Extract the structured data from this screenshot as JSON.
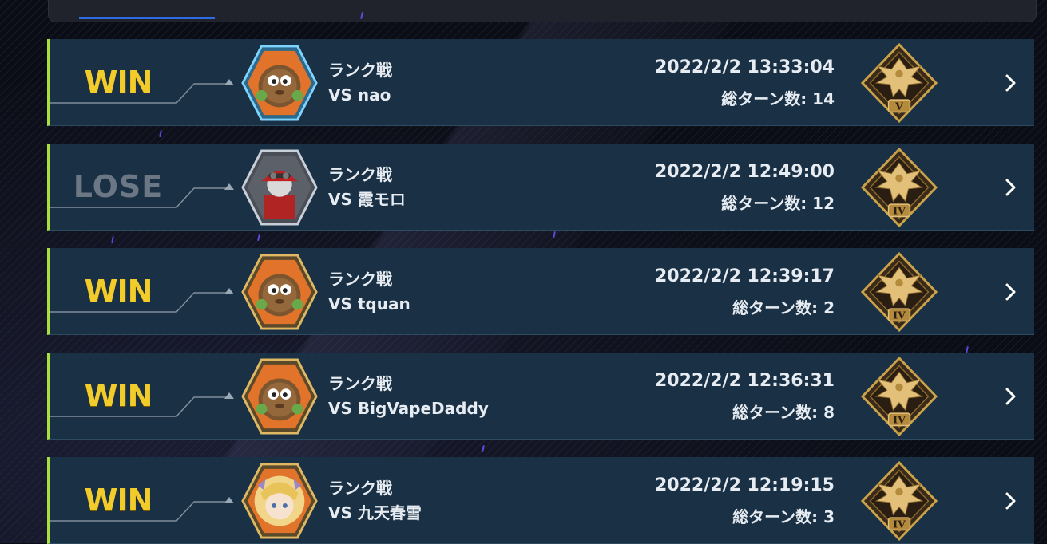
{
  "colors": {
    "win": "#f2cc2a",
    "lose": "#6c7785",
    "row_bg": "#1a3044",
    "row_accent": "#a8e03c",
    "text": "#e6ecf2",
    "gold": "#c9a24a"
  },
  "matches": [
    {
      "result": "WIN",
      "result_type": "win",
      "avatar_icon": "kuriboh-avatar-icon",
      "avatar_frame": "blue",
      "match_type": "ランク戦",
      "opponent": "VS nao",
      "datetime": "2022/2/2 13:33:04",
      "turns": "総ターン数: 14",
      "rank_numeral": "V",
      "rank_icon": "rank-v-badge-icon"
    },
    {
      "result": "LOSE",
      "result_type": "lose",
      "avatar_icon": "red-cap-duelist-avatar-icon",
      "avatar_frame": "silver",
      "match_type": "ランク戦",
      "opponent": "VS 霞モロ",
      "datetime": "2022/2/2 12:49:00",
      "turns": "総ターン数: 12",
      "rank_numeral": "IV",
      "rank_icon": "rank-iv-badge-icon"
    },
    {
      "result": "WIN",
      "result_type": "win",
      "avatar_icon": "kuriboh-avatar-icon",
      "avatar_frame": "gold",
      "match_type": "ランク戦",
      "opponent": "VS tquan",
      "datetime": "2022/2/2 12:39:17",
      "turns": "総ターン数: 2",
      "rank_numeral": "IV",
      "rank_icon": "rank-iv-badge-icon"
    },
    {
      "result": "WIN",
      "result_type": "win",
      "avatar_icon": "kuriboh-avatar-icon",
      "avatar_frame": "gold",
      "match_type": "ランク戦",
      "opponent": "VS BigVapeDaddy",
      "datetime": "2022/2/2 12:36:31",
      "turns": "総ターン数: 8",
      "rank_numeral": "IV",
      "rank_icon": "rank-iv-badge-icon"
    },
    {
      "result": "WIN",
      "result_type": "win",
      "avatar_icon": "blonde-girl-avatar-icon",
      "avatar_frame": "gold",
      "match_type": "ランク戦",
      "opponent": "VS 九天春雪",
      "datetime": "2022/2/2 12:19:15",
      "turns": "総ターン数: 3",
      "rank_numeral": "IV",
      "rank_icon": "rank-iv-badge-icon"
    }
  ]
}
